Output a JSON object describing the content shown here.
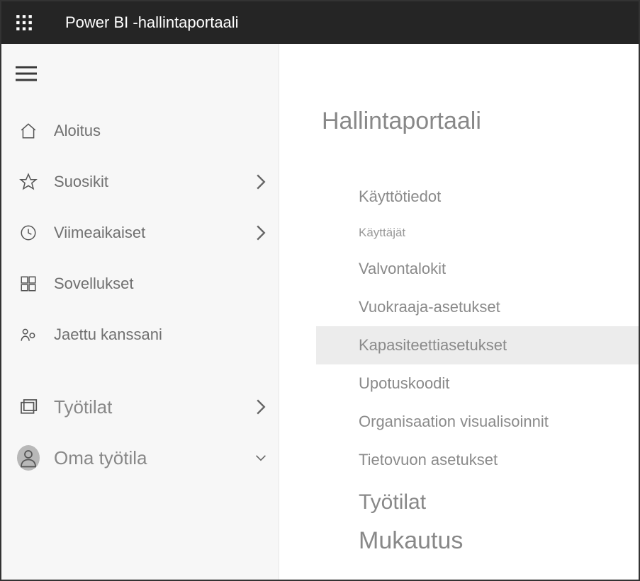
{
  "header": {
    "title": "Power BI -hallintaportaali"
  },
  "sidebar": {
    "items": [
      {
        "id": "home",
        "label": "Aloitus",
        "icon": "home",
        "expandable": false
      },
      {
        "id": "favorites",
        "label": "Suosikit",
        "icon": "star",
        "expandable": true
      },
      {
        "id": "recent",
        "label": "Viimeaikaiset",
        "icon": "clock",
        "expandable": true
      },
      {
        "id": "apps",
        "label": "Sovellukset",
        "icon": "apps",
        "expandable": false
      },
      {
        "id": "shared",
        "label": "Jaettu kanssani",
        "icon": "shared",
        "expandable": false
      }
    ],
    "workspaces": {
      "label": "Työtilat"
    },
    "myworkspace": {
      "label": "Oma työtila"
    }
  },
  "main": {
    "title": "Hallintaportaali",
    "items": [
      {
        "id": "usage",
        "label": "Käyttötiedot",
        "style": "normal"
      },
      {
        "id": "users",
        "label": "Käyttäjät",
        "style": "small"
      },
      {
        "id": "audit",
        "label": "Valvontalokit",
        "style": "normal"
      },
      {
        "id": "tenant",
        "label": "Vuokraaja-asetukset",
        "style": "normal"
      },
      {
        "id": "capacity",
        "label": "Kapasiteettiasetukset",
        "style": "normal",
        "selected": true
      },
      {
        "id": "embed",
        "label": "Upotuskoodit",
        "style": "normal"
      },
      {
        "id": "visuals",
        "label": "Organisaation visualisoinnit",
        "style": "normal"
      },
      {
        "id": "dataflow",
        "label": "Tietovuon asetukset",
        "style": "normal"
      },
      {
        "id": "ws",
        "label": "Työtilat",
        "style": "large1"
      },
      {
        "id": "custom",
        "label": "Mukautus",
        "style": "large2"
      }
    ]
  }
}
